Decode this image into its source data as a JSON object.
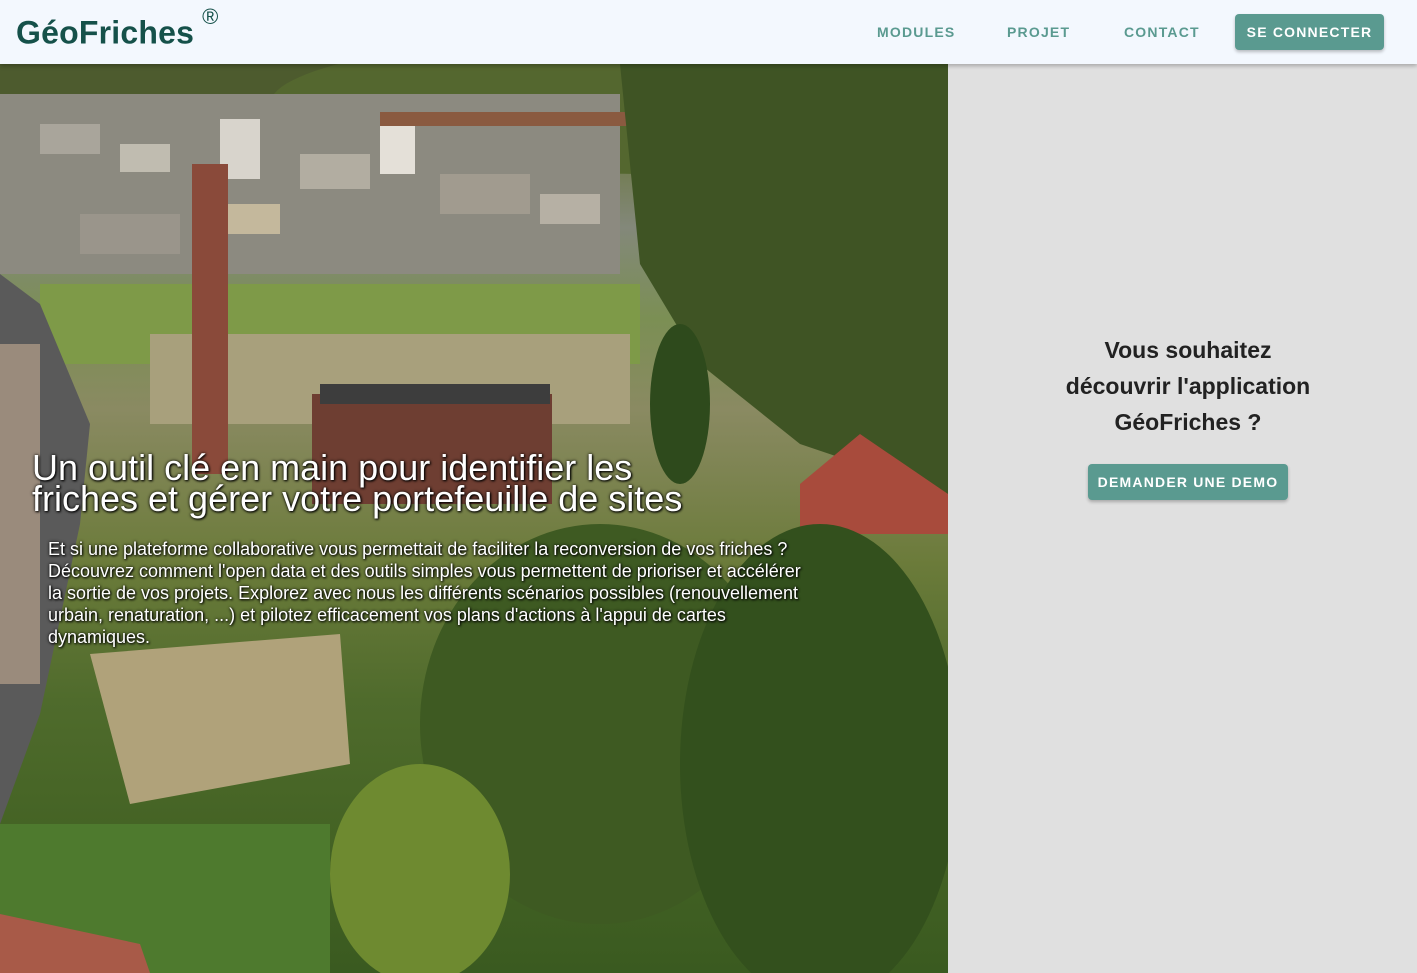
{
  "header": {
    "brand": "GéoFriches",
    "brand_mark": "®",
    "nav": {
      "modules": "MODULES",
      "projet": "PROJET",
      "contact": "CONTACT"
    },
    "login_label": "SE CONNECTER"
  },
  "hero": {
    "title_line1": "Un outil clé en main pour identifier les",
    "title_line2": "friches et gérer votre portefeuille de sites",
    "text_lines": [
      "Et si une plateforme collaborative vous permettait de faciliter la reconversion de vos friches ?",
      "Découvrez comment l'open data et des outils simples vous permettent de prioriser et accélérer",
      "la sortie de vos projets. Explorez avec nous les différents scénarios possibles (renouvellement",
      "urbain, renaturation, ...) et pilotez efficacement vos plans d'actions à l'appui de cartes",
      "dynamiques."
    ]
  },
  "side_panel": {
    "title_lines": [
      "Vous souhaitez",
      "découvrir l'application",
      "GéoFriches ?"
    ],
    "demo_label": "DEMANDER UNE DEMO"
  },
  "colors": {
    "accent": "#5a9a90",
    "brand": "#15514a",
    "navbar_bg": "#f3f8fe",
    "panel_bg": "#e0e0e0"
  }
}
